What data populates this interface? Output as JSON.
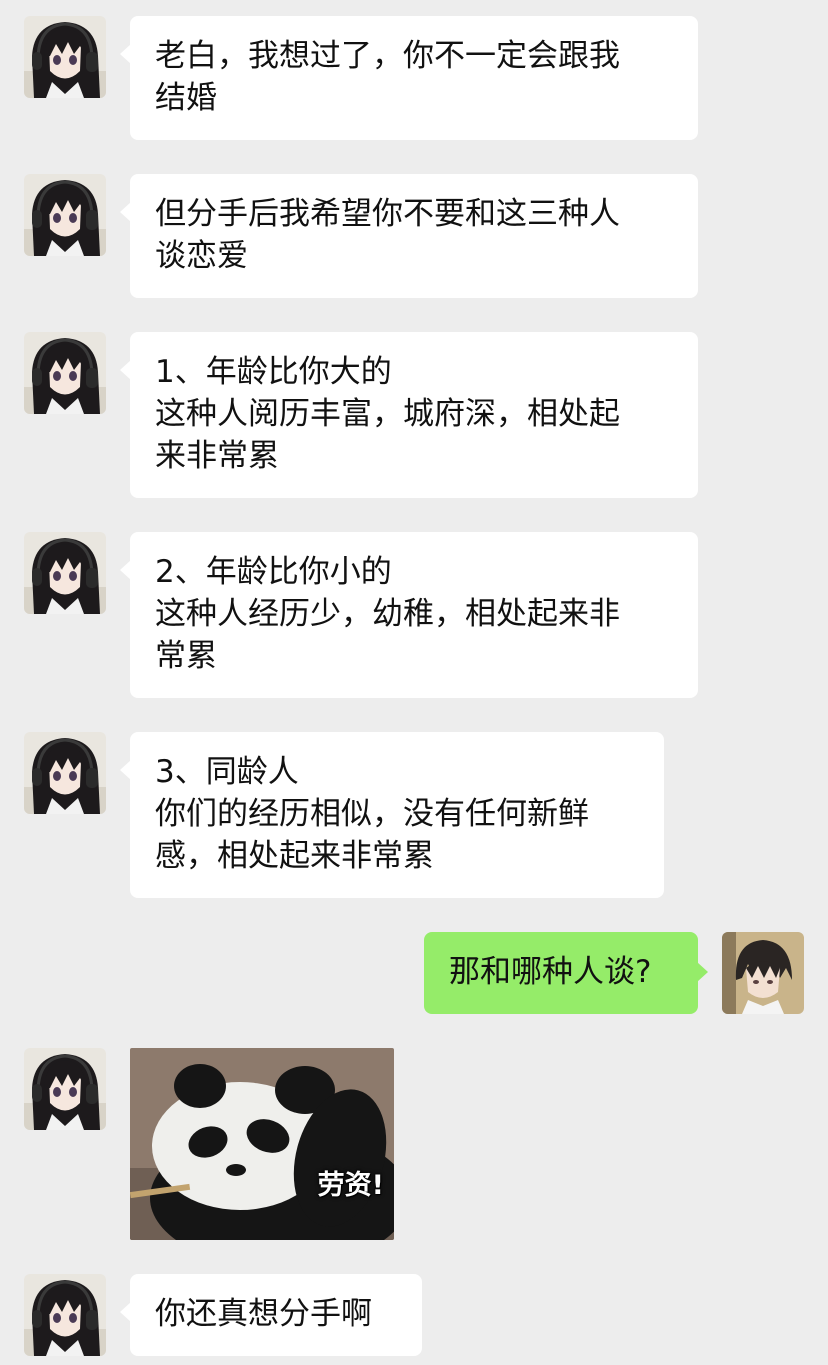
{
  "messages": [
    {
      "side": "left",
      "lines": [
        "老白，我想过了，你不一定会跟我",
        "结婚"
      ]
    },
    {
      "side": "left",
      "lines": [
        "但分手后我希望你不要和这三种人",
        "谈恋爱"
      ]
    },
    {
      "side": "left",
      "lines": [
        "1、年龄比你大的",
        "这种人阅历丰富，城府深，相处起",
        "来非常累"
      ]
    },
    {
      "side": "left",
      "lines": [
        "2、年龄比你小的",
        "这种人经历少，幼稚，相处起来非",
        "常累"
      ]
    },
    {
      "side": "left",
      "lines": [
        "3、同龄人",
        "你们的经历相似，没有任何新鲜",
        "感，相处起来非常累"
      ]
    },
    {
      "side": "right",
      "lines": [
        "那和哪种人谈?"
      ]
    },
    {
      "side": "left",
      "sticker": {
        "subject": "panda",
        "caption": "劳资!"
      }
    },
    {
      "side": "left",
      "lines": [
        "你还真想分手啊"
      ]
    }
  ],
  "colors": {
    "background": "#ededed",
    "left_bubble": "#ffffff",
    "right_bubble": "#95ec69",
    "text": "#111111"
  },
  "avatars": {
    "left": "anime-girl-headphones-avatar",
    "right": "anime-boy-avatar"
  }
}
